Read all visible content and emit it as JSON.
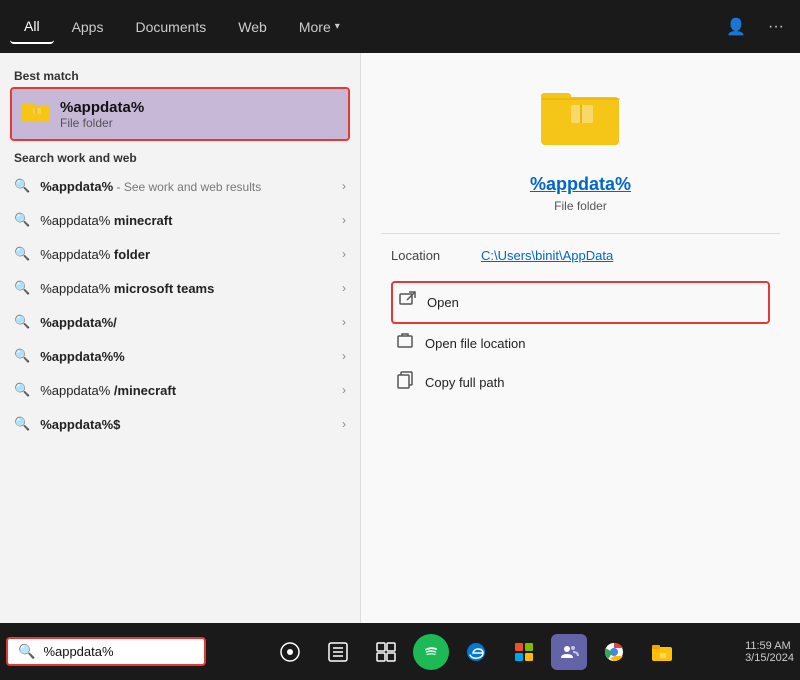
{
  "nav": {
    "tabs": [
      {
        "label": "All",
        "active": true
      },
      {
        "label": "Apps",
        "active": false
      },
      {
        "label": "Documents",
        "active": false
      },
      {
        "label": "Web",
        "active": false
      },
      {
        "label": "More",
        "active": false,
        "has_chevron": true
      }
    ],
    "icons": {
      "person": "👤",
      "dots": "···"
    }
  },
  "left_panel": {
    "best_match_label": "Best match",
    "best_match": {
      "title": "%appdata%",
      "subtitle": "File folder"
    },
    "search_section_label": "Search work and web",
    "results": [
      {
        "text": "%appdata%",
        "suffix": " - See work and web results",
        "has_chevron": true
      },
      {
        "text": "%appdata% minecraft",
        "has_chevron": true
      },
      {
        "text": "%appdata% folder",
        "has_chevron": true
      },
      {
        "text": "%appdata% microsoft teams",
        "has_chevron": true
      },
      {
        "text": "%appdata%/",
        "has_chevron": true
      },
      {
        "text": "%appdata%%",
        "has_chevron": true
      },
      {
        "text": "%appdata%/minecraft",
        "has_chevron": true
      },
      {
        "text": "%appdata%$",
        "has_chevron": true
      }
    ]
  },
  "right_panel": {
    "title": "%appdata%",
    "subtitle": "File folder",
    "location_label": "Location",
    "location_value": "C:\\Users\\binit\\AppData",
    "actions": [
      {
        "label": "Open",
        "highlighted": true,
        "icon": "open"
      },
      {
        "label": "Open file location",
        "highlighted": false,
        "icon": "location"
      },
      {
        "label": "Copy full path",
        "highlighted": false,
        "icon": "copy"
      }
    ]
  },
  "taskbar": {
    "search_value": "%appdata%",
    "search_placeholder": "%appdata%",
    "buttons": [
      {
        "label": "⊙",
        "name": "start-btn"
      },
      {
        "label": "⊞",
        "name": "search-btn"
      },
      {
        "label": "▦",
        "name": "task-view-btn"
      },
      {
        "label": "🎵",
        "name": "spotify-btn"
      },
      {
        "label": "🌐",
        "name": "edge-btn"
      },
      {
        "label": "📦",
        "name": "office-btn"
      },
      {
        "label": "👥",
        "name": "teams-btn"
      },
      {
        "label": "🔵",
        "name": "chrome-btn"
      },
      {
        "label": "📁",
        "name": "explorer-btn"
      }
    ]
  }
}
